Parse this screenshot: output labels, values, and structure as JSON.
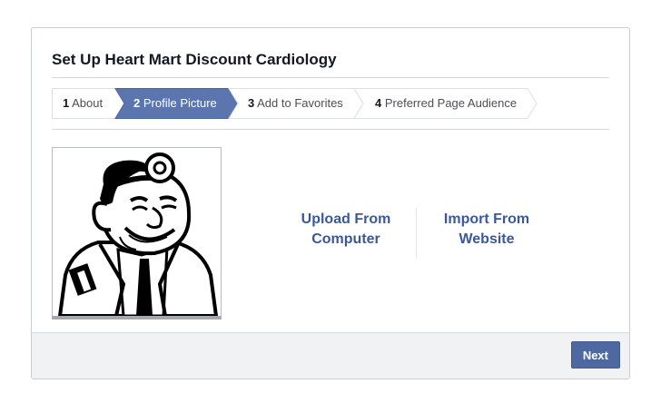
{
  "dialog": {
    "title": "Set Up Heart Mart Discount Cardiology"
  },
  "steps": [
    {
      "number": "1",
      "label": "About",
      "state": "inactive"
    },
    {
      "number": "2",
      "label": "Profile Picture",
      "state": "active"
    },
    {
      "number": "3",
      "label": "Add to Favorites",
      "state": "inactive"
    },
    {
      "number": "4",
      "label": "Preferred Page Audience",
      "state": "inactive"
    }
  ],
  "profile_picture": {
    "image": "cartoon-doctor-with-head-mirror"
  },
  "actions": {
    "upload_label": "Upload From Computer",
    "import_label": "Import From Website"
  },
  "footer": {
    "next_label": "Next"
  },
  "colors": {
    "active_step": "#5b76ae",
    "link": "#3b5998",
    "button": "#4e69a2",
    "footer_bg": "#f1f2f4"
  }
}
